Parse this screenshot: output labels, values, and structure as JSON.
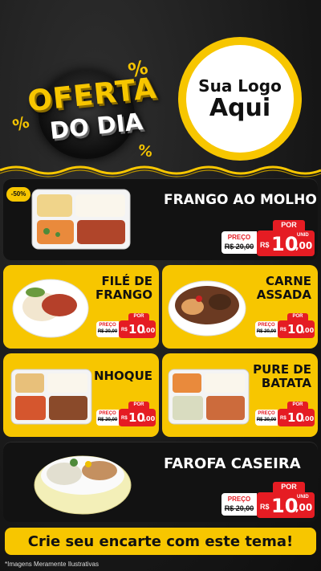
{
  "header": {
    "promo_line1": "OFERTA",
    "promo_line2": "DO DIA",
    "percent_symbol": "%",
    "logo_line1": "Sua Logo",
    "logo_line2": "Aqui"
  },
  "colors": {
    "accent_yellow": "#f7c600",
    "price_red": "#e51c23",
    "dark_bg": "#161616"
  },
  "products": [
    {
      "id": "frango-ao-molho",
      "title": "FRANGO AO MOLHO",
      "discount": "-50%",
      "por": "POR",
      "preco_label": "PREÇO",
      "old_price": "R$ 20,00",
      "currency": "R$",
      "price_int": "10",
      "price_dec": ",00",
      "unit": "UNID"
    },
    {
      "id": "file-de-frango",
      "title": "FILÉ DE FRANGO",
      "por": "POR",
      "preco_label": "PREÇO",
      "old_price": "R$ 20,00",
      "currency": "R$",
      "price_int": "10",
      "price_dec": ",00",
      "unit": "UNID"
    },
    {
      "id": "carne-assada",
      "title": "CARNE ASSADA",
      "por": "POR",
      "preco_label": "PREÇO",
      "old_price": "R$ 20,00",
      "currency": "R$",
      "price_int": "10",
      "price_dec": ",00",
      "unit": "UNID"
    },
    {
      "id": "nhoque",
      "title": "NHOQUE",
      "por": "POR",
      "preco_label": "PREÇO",
      "old_price": "R$ 20,00",
      "currency": "R$",
      "price_int": "10",
      "price_dec": ",00",
      "unit": "UNID"
    },
    {
      "id": "pure-de-batata",
      "title": "PURE DE BATATA",
      "por": "POR",
      "preco_label": "PREÇO",
      "old_price": "R$ 20,00",
      "currency": "R$",
      "price_int": "10",
      "price_dec": ",00",
      "unit": "UNID"
    },
    {
      "id": "farofa-caseira",
      "title": "FAROFA CASEIRA",
      "por": "POR",
      "preco_label": "PREÇO",
      "old_price": "R$ 20,00",
      "currency": "R$",
      "price_int": "10",
      "price_dec": ",00",
      "unit": "UNID"
    }
  ],
  "cta": "Crie seu encarte com este tema!",
  "footnote": "*Imagens Meramente Ilustrativas"
}
